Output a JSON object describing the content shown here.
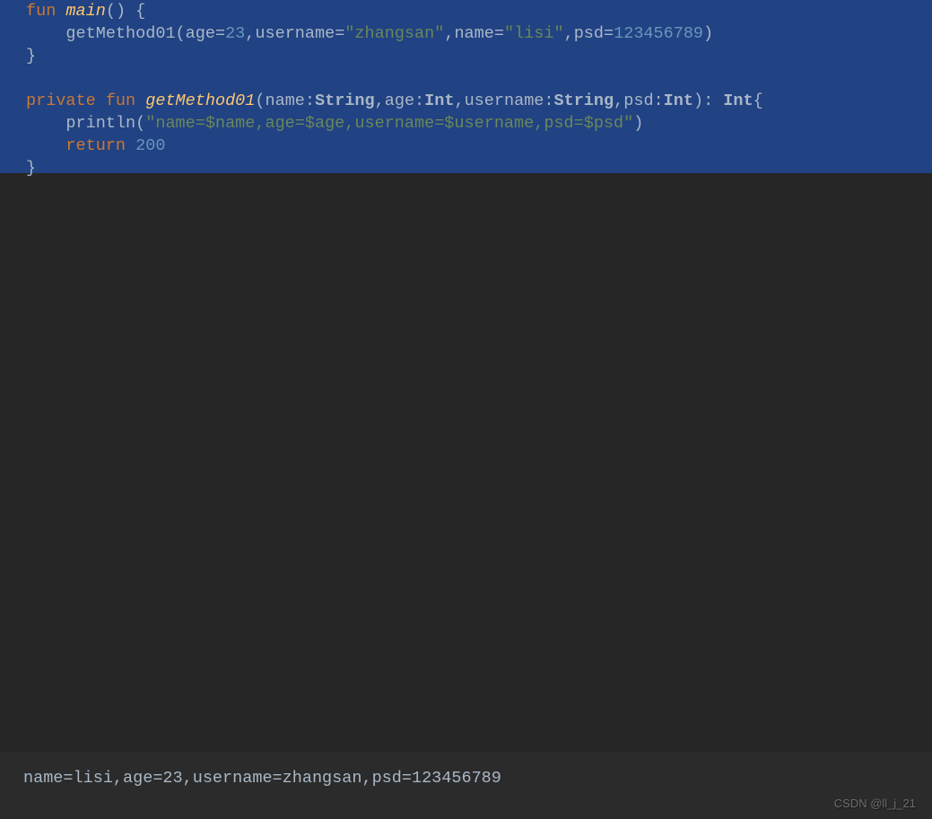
{
  "code": {
    "line1": {
      "keyword_fun": "fun",
      "func_name": "main",
      "parens_brace": "() {"
    },
    "line2": {
      "indent": "    ",
      "call_prefix": "getMethod01(age=",
      "num_23": "23",
      "username_part": ",username=",
      "str_zhangsan": "\"zhangsan\"",
      "name_part": ",name=",
      "str_lisi": "\"lisi\"",
      "psd_part": ",psd=",
      "num_psd": "123456789",
      "close": ")"
    },
    "line3": {
      "close_brace": "}"
    },
    "line5": {
      "keyword_private": "private",
      "keyword_fun": "fun",
      "func_name": "getMethod01",
      "open_paren": "(",
      "p_name": "name:",
      "t_string1": "String",
      "comma1": ",",
      "p_age": "age:",
      "t_int1": "Int",
      "comma2": ",",
      "p_username": "username:",
      "t_string2": "String",
      "comma3": ",",
      "p_psd": "psd:",
      "t_int2": "Int",
      "close_paren_colon": "): ",
      "ret_type": "Int",
      "open_brace": "{"
    },
    "line6": {
      "indent": "    ",
      "println": "println(",
      "str_template": "\"name=$name,age=$age,username=$username,psd=$psd\"",
      "close": ")"
    },
    "line7": {
      "indent": "    ",
      "keyword_return": "return",
      "space": " ",
      "num_200": "200"
    },
    "line8": {
      "close_brace": "}"
    }
  },
  "console": {
    "output": "name=lisi,age=23,username=zhangsan,psd=123456789"
  },
  "watermark": "CSDN @ll_j_21"
}
